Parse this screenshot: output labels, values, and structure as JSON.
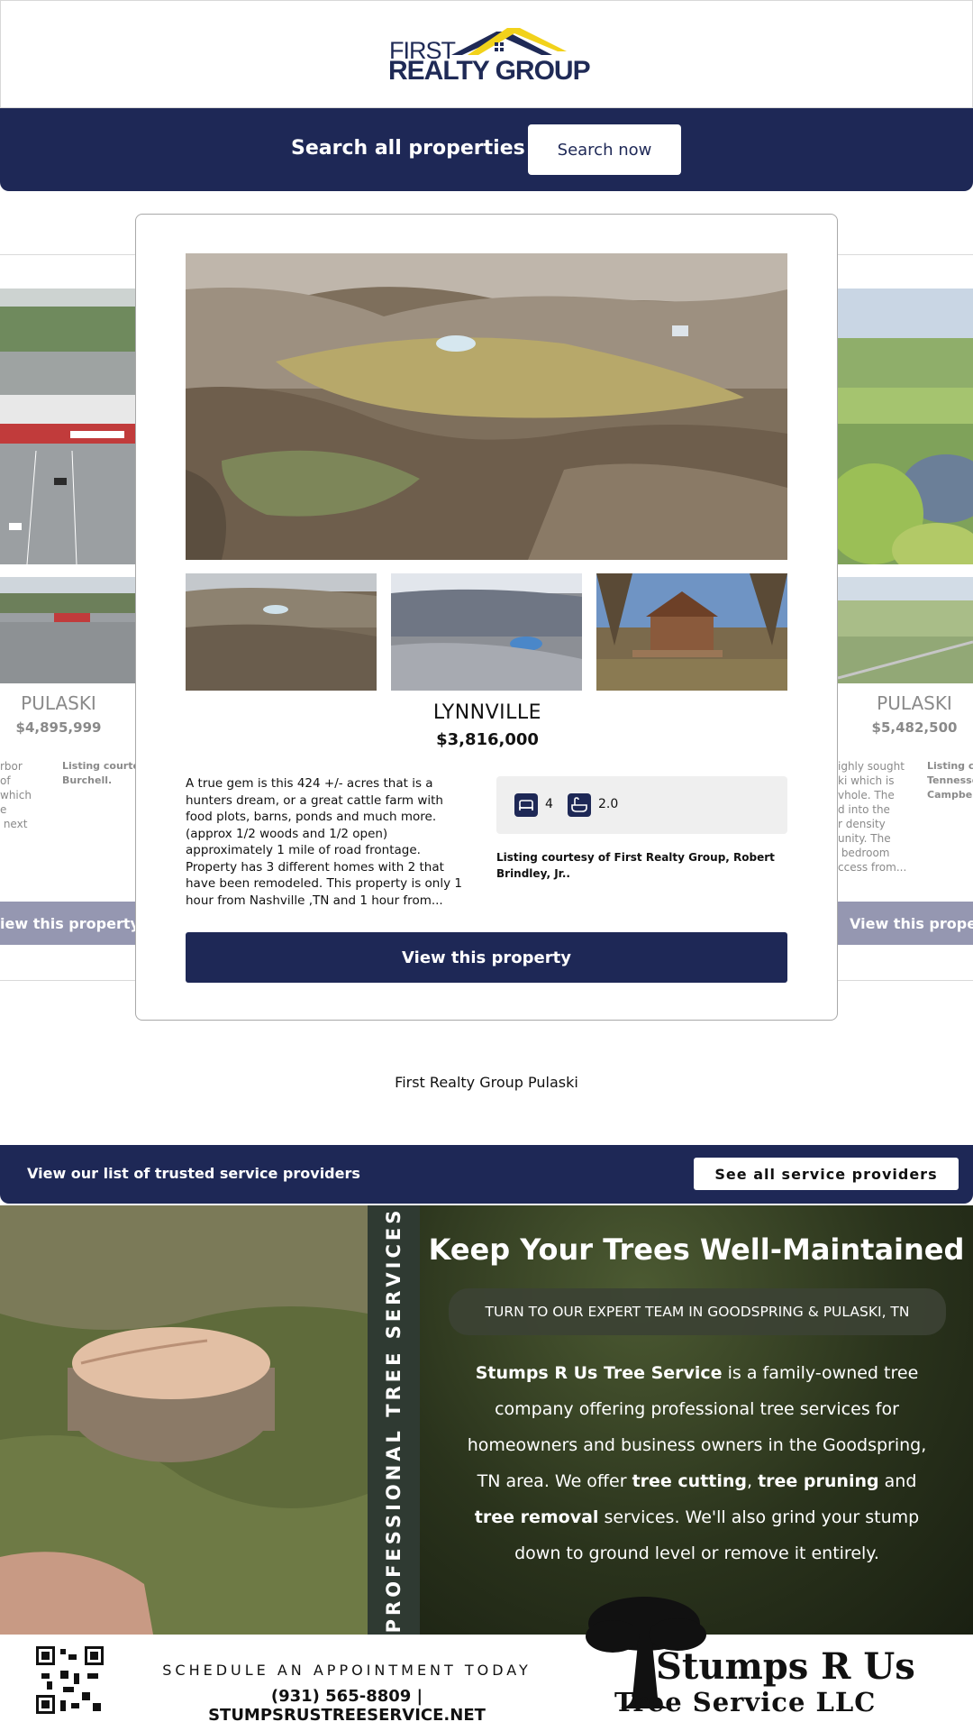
{
  "header": {
    "logo_line1": "FIRST",
    "logo_line2": "REALTY GROUP"
  },
  "search": {
    "title": "Search all properties",
    "button": "Search now"
  },
  "carousel": {
    "left": {
      "city": "PULASKI",
      "price": "$4,895,999",
      "desc_lines": "rbor\nof\nwhich\ne\n next",
      "courtesy": "Listing courte\nBurchell.",
      "button": "iew this property"
    },
    "right": {
      "city": "PULASKI",
      "price": "$5,482,500",
      "desc_lines": "ighly sought\nki which is\nvhole. The\nd into the\nr density\nunity. The\n bedroom\nccess from...",
      "courtesy": "Listing c\nTennesse\nCampbel",
      "button": "View this proper"
    },
    "featured": {
      "city": "LYNNVILLE",
      "price": "$3,816,000",
      "description": "A true gem is this 424 +/- acres that is a hunters dream, or a great cattle farm with food plots, barns, ponds and much more. (approx 1/2 woods and 1/2 open) approximately 1 mile of road frontage. Property has 3 different homes with 2 that have been remodeled. This property is only 1 hour from Nashville ,TN and 1 hour from...",
      "beds": "4",
      "baths": "2.0",
      "courtesy": "Listing courtesy of First Realty Group, Robert Brindley, Jr..",
      "button": "View this property"
    }
  },
  "office": "First Realty Group Pulaski",
  "services": {
    "text": "View our list of trusted service providers",
    "button": "See all service providers"
  },
  "ad": {
    "strip": "PROFESSIONAL TREE SERVICES",
    "title": "Keep Your Trees Well-Maintained",
    "pill": "TURN TO OUR EXPERT TEAM IN GOODSPRING & PULASKI, TN",
    "body": {
      "company": "Stumps R Us Tree Service",
      "t1": " is a family-owned tree company offering professional tree services for homeowners and business owners in the Goodspring, TN area. We offer ",
      "s1": "tree cutting",
      "t2": ", ",
      "s2": "tree pruning",
      "t3": " and ",
      "s3": "tree removal",
      "t4": " services. We'll also grind your stump down to ground level or remove it entirely."
    },
    "schedule": "SCHEDULE AN APPOINTMENT TODAY",
    "phone": "(931) 565-8809 | STUMPSRUSTREESERVICE.NET",
    "brand1": "Stumps R Us",
    "brand2": "Tree Service LLC"
  },
  "colors": {
    "navy": "#1e2856",
    "muted_button": "#9597b1",
    "logo_yellow": "#f2d21b"
  }
}
